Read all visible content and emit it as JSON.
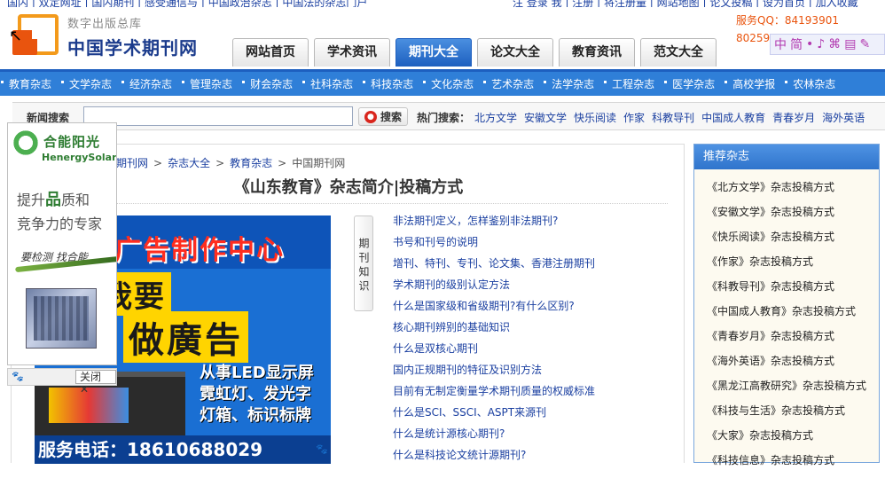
{
  "top_strip": {
    "left": "国内 | 双定网址 | 国内期刊 | 感受通信与 | 中国政治杂志 | 中国法的杂志门户",
    "right": "注 登录 我 | 注册 | 将注册量 | 网站地图 | 论文投稿 | 设为首页 | 加入收藏"
  },
  "brand": {
    "sub": "数字出版总库",
    "main": "中国学术期刊网"
  },
  "nav": {
    "tabs": [
      {
        "label": "网站首页",
        "active": false
      },
      {
        "label": "学术资讯",
        "active": false
      },
      {
        "label": "期刊大全",
        "active": true
      },
      {
        "label": "论文大全",
        "active": false
      },
      {
        "label": "教育资讯",
        "active": false
      },
      {
        "label": "范文大全",
        "active": false
      }
    ]
  },
  "service": {
    "qq_line": "服务QQ：84193901",
    "qq_line2": "80259"
  },
  "toolbar": {
    "items": [
      "中",
      "简",
      "•",
      "♪",
      "⌘",
      "▤",
      "✎"
    ]
  },
  "categories": [
    "教育杂志",
    "文学杂志",
    "经济杂志",
    "管理杂志",
    "财会杂志",
    "社科杂志",
    "科技杂志",
    "文化杂志",
    "艺术杂志",
    "法学杂志",
    "工程杂志",
    "医学杂志",
    "高校学报",
    "农林杂志"
  ],
  "search": {
    "label": "新闻搜索",
    "value": "",
    "button": "搜索",
    "hot_label": "热门搜索：",
    "hot": [
      "北方文学",
      "安徽文学",
      "快乐阅读",
      "作家",
      "科教导刊",
      "中国成人教育",
      "青春岁月",
      "海外英语"
    ]
  },
  "breadcrumb": [
    "国期刊网",
    "杂志大全",
    "教育杂志",
    "中国期刊网"
  ],
  "article": {
    "title": "《山东教育》杂志简介|投稿方式"
  },
  "ad": {
    "line1": "广告制作中心",
    "line2": "我要",
    "line3": "做廣告",
    "line4": "从事LED显示屏",
    "line5": "霓虹灯、发光字",
    "line6": "灯箱、标识标牌",
    "phone": "服务电话：18610688029"
  },
  "knowledge": {
    "label": "期刊知识",
    "links": [
      "非法期刊定义，怎样鉴别非法期刊?",
      "书号和刊号的说明",
      "增刊、特刊、专刊、论文集、香港注册期刊",
      "学术期刊的级别认定方法",
      "什么是国家级和省级期刊?有什么区别?",
      "核心期刊辨别的基础知识",
      "什么是双核心期刊",
      "国内正规期刊的特征及识别方法",
      "目前有无制定衡量学术期刊质量的权威标准",
      "什么是SCI、SSCI、ASPT来源刊",
      "什么是统计源核心期刊?",
      "什么是科技论文统计源期刊?"
    ]
  },
  "recommend": {
    "title": "推荐杂志",
    "items": [
      "《北方文学》杂志投稿方式",
      "《安徽文学》杂志投稿方式",
      "《快乐阅读》杂志投稿方式",
      "《作家》杂志投稿方式",
      "《科教导刊》杂志投稿方式",
      "《中国成人教育》杂志投稿方式",
      "《青春岁月》杂志投稿方式",
      "《海外英语》杂志投稿方式",
      "《黑龙江高教研究》杂志投稿方式",
      "《科技与生活》杂志投稿方式",
      "《大家》杂志投稿方式",
      "《科技信息》杂志投稿方式"
    ]
  },
  "float_ad": {
    "brand_cn": "合能阳光",
    "brand_en": "HenergySolar",
    "slogan1a": "提升",
    "slogan1b": "品",
    "slogan1c": "质和",
    "slogan2": "竞争力的专家",
    "sign": "要检测 找合能",
    "close": "关闭"
  }
}
